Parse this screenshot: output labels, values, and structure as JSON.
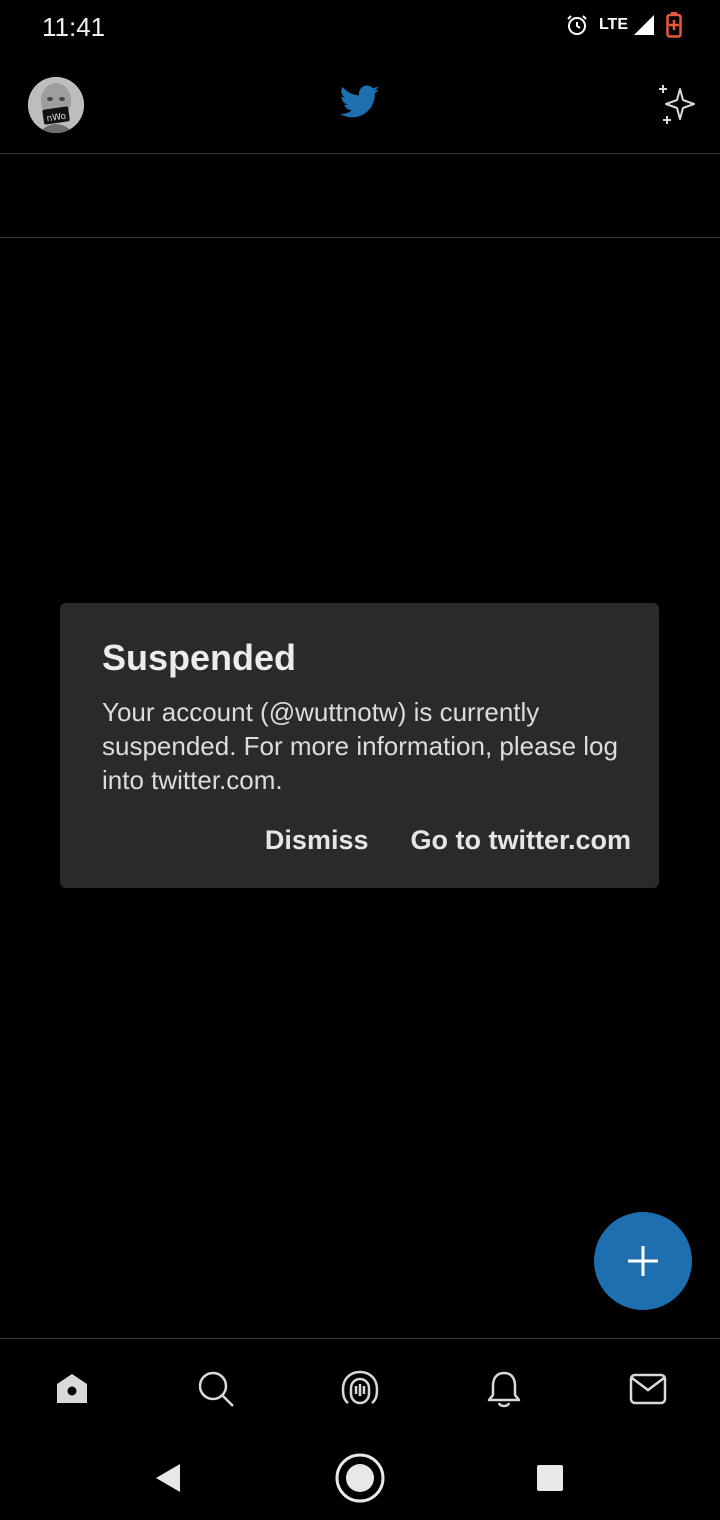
{
  "status_bar": {
    "time": "11:41",
    "network": "LTE"
  },
  "header": {
    "avatar_text": "nWo"
  },
  "dialog": {
    "title": "Suspended",
    "message": "Your account (@wuttnotw) is currently suspended. For more information, please log into twitter.com.",
    "dismiss_label": "Dismiss",
    "goto_label": "Go to twitter.com"
  },
  "colors": {
    "accent": "#1d6fb0",
    "dialog_bg": "#2a2a2a",
    "battery": "#e8593c"
  },
  "icons": {
    "header": [
      "avatar",
      "twitter-bird-icon",
      "sparkle-icon"
    ],
    "bottom_nav": [
      "home-icon",
      "search-icon",
      "spaces-icon",
      "notifications-icon",
      "messages-icon"
    ],
    "system_nav": [
      "back-icon",
      "home-circle-icon",
      "recents-icon"
    ]
  }
}
